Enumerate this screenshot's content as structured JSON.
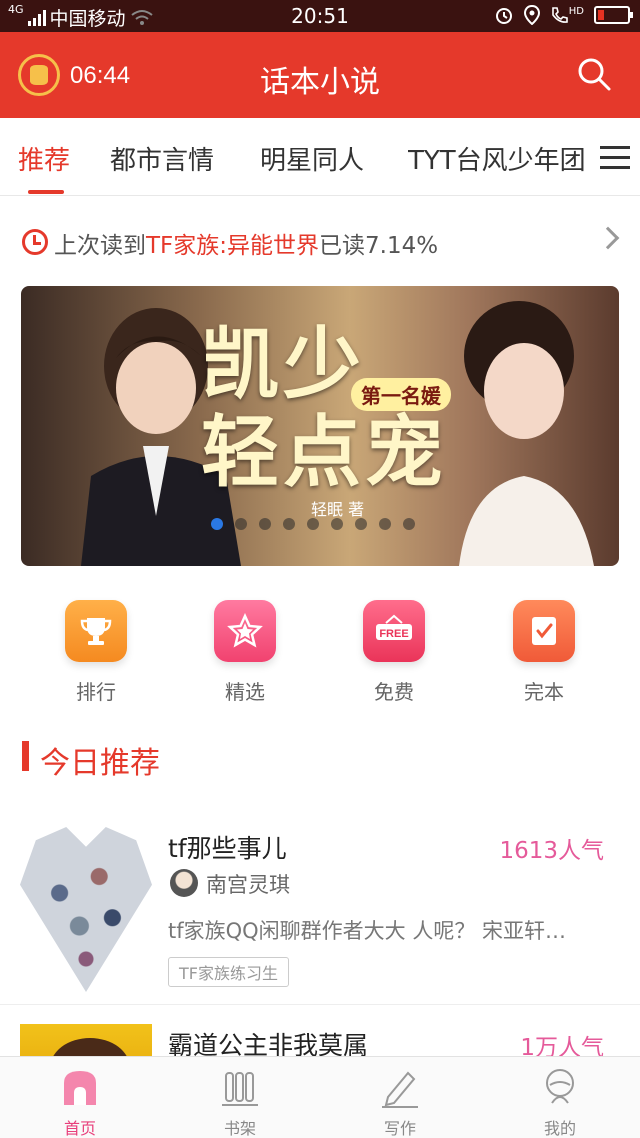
{
  "status_bar": {
    "network": "4G",
    "carrier": "中国移动",
    "time": "20:51",
    "hd": "HD"
  },
  "header": {
    "timer": "06:44",
    "title": "话本小说"
  },
  "tabs": [
    {
      "label": "推荐",
      "active": true
    },
    {
      "label": "都市言情",
      "active": false
    },
    {
      "label": "明星同人",
      "active": false
    },
    {
      "label": "TYT台风少年团",
      "active": false
    }
  ],
  "last_read": {
    "prefix": "上次读到",
    "book": "TF家族:异能世界",
    "suffix": "已读7.14%"
  },
  "banner": {
    "title_line1": "凯少",
    "title_line2": "轻点宠",
    "badge": "第一名媛",
    "author": "轻眠 著",
    "slide_count": 9,
    "active_slide": 1
  },
  "categories": [
    {
      "label": "排行",
      "icon": "trophy-icon",
      "color": "#f5931f"
    },
    {
      "label": "精选",
      "icon": "star-icon",
      "color": "#f1426f"
    },
    {
      "label": "免费",
      "icon": "free-sign-icon",
      "color": "#ea3459"
    },
    {
      "label": "完本",
      "icon": "check-note-icon",
      "color": "#f05a38"
    }
  ],
  "section": {
    "title": "今日推荐"
  },
  "books": [
    {
      "title": "tf那些事儿",
      "popularity": "1613人气",
      "author": "南宫灵琪",
      "description": "tf家族QQ闲聊群作者大大 人呢？ 宋亚轩…",
      "tag": "TF家族练习生"
    },
    {
      "title": "霸道公主非我莫属",
      "popularity": "1万人气"
    }
  ],
  "bottom_nav": [
    {
      "label": "首页",
      "icon": "home-icon",
      "active": true
    },
    {
      "label": "书架",
      "icon": "bookshelf-icon",
      "active": false
    },
    {
      "label": "写作",
      "icon": "pen-icon",
      "active": false
    },
    {
      "label": "我的",
      "icon": "profile-icon",
      "active": false
    }
  ],
  "colors": {
    "brand": "#e5392b",
    "popularity": "#e55a9a",
    "nav_active": "#e8407c"
  }
}
